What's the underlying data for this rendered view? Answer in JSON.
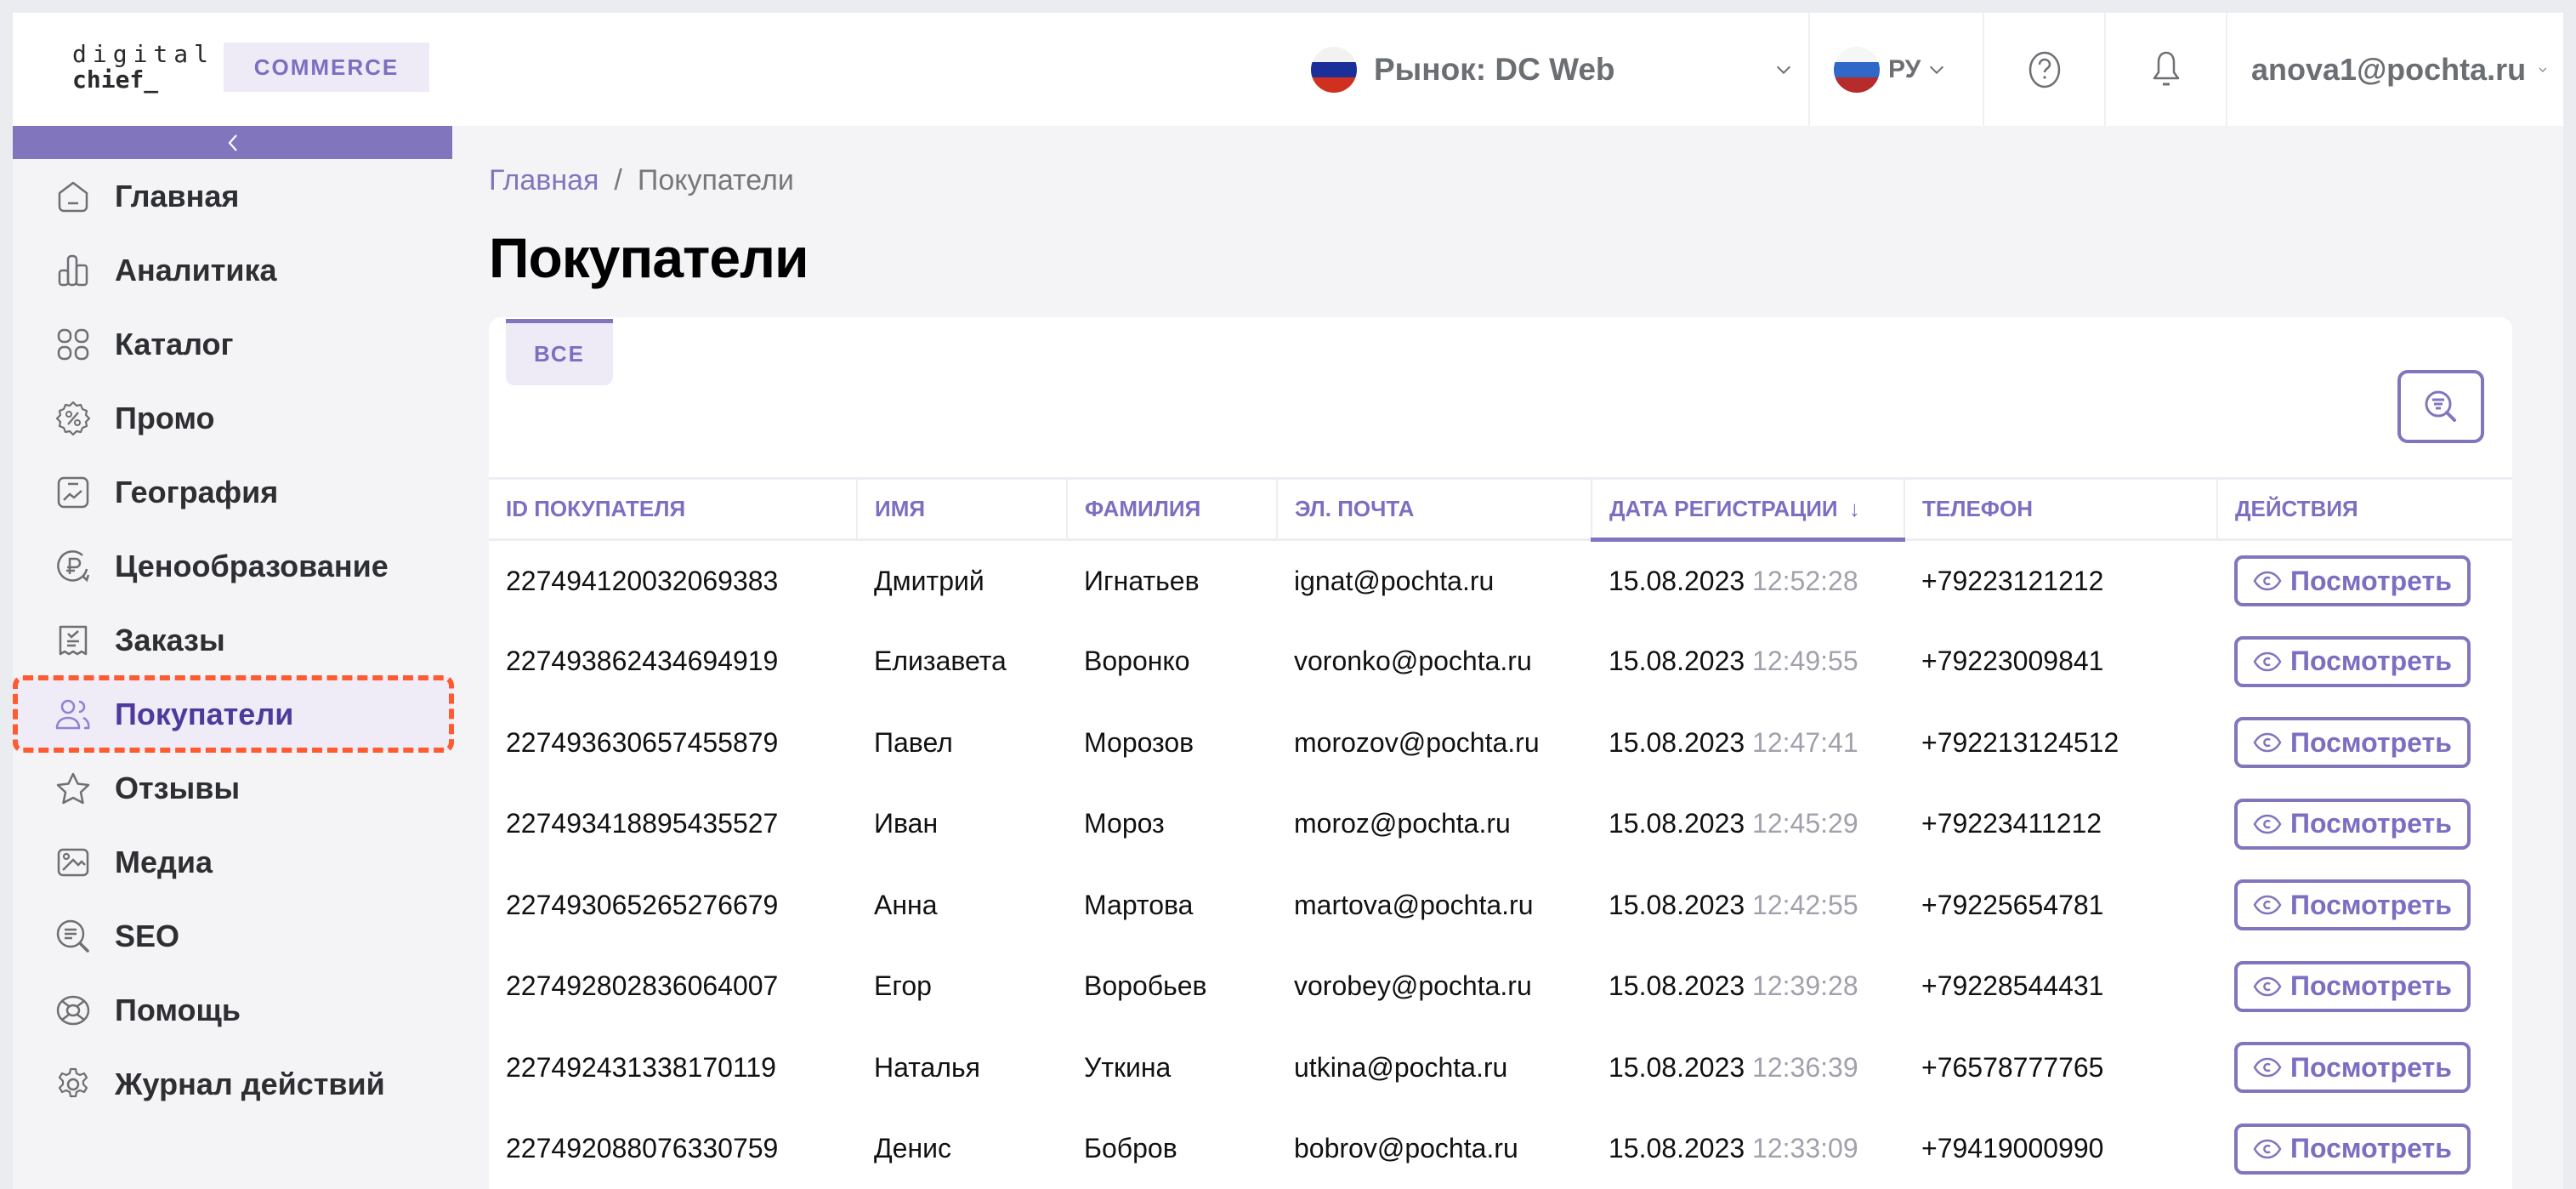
{
  "brand": {
    "logo_line1": "digital",
    "logo_line2": "chief_",
    "product_badge": "COMMERCE",
    "accent_color": "#8176bd"
  },
  "header": {
    "market_label": "Рынок: DC Web",
    "language": "РУ",
    "help_icon": "question-circle-icon",
    "notifications_icon": "bell-icon",
    "user_email": "anova1@pochta.ru"
  },
  "sidebar": {
    "collapse_icon": "chevron-left-icon",
    "items": [
      {
        "label": "Главная",
        "icon": "home-icon",
        "active": false
      },
      {
        "label": "Аналитика",
        "icon": "bar-chart-icon",
        "active": false
      },
      {
        "label": "Каталог",
        "icon": "grid-icon",
        "active": false
      },
      {
        "label": "Промо",
        "icon": "percent-badge-icon",
        "active": false
      },
      {
        "label": "География",
        "icon": "trend-chart-icon",
        "active": false
      },
      {
        "label": "Ценообразование",
        "icon": "ruble-refresh-icon",
        "active": false
      },
      {
        "label": "Заказы",
        "icon": "receipt-check-icon",
        "active": false
      },
      {
        "label": "Покупатели",
        "icon": "users-icon",
        "active": true
      },
      {
        "label": "Отзывы",
        "icon": "star-icon",
        "active": false
      },
      {
        "label": "Медиа",
        "icon": "image-icon",
        "active": false
      },
      {
        "label": "SEO",
        "icon": "search-text-icon",
        "active": false
      },
      {
        "label": "Помощь",
        "icon": "lifebuoy-icon",
        "active": false
      },
      {
        "label": "Журнал действий",
        "icon": "gear-icon",
        "active": false
      }
    ]
  },
  "breadcrumb": {
    "home": "Главная",
    "separator": "/",
    "current": "Покупатели"
  },
  "page": {
    "title": "Покупатели",
    "tab_all": "ВСЕ",
    "filter_icon": "search-filter-icon"
  },
  "table": {
    "columns": [
      "ID ПОКУПАТЕЛЯ",
      "ИМЯ",
      "ФАМИЛИЯ",
      "ЭЛ. ПОЧТА",
      "ДАТА РЕГИСТРАЦИИ",
      "ТЕЛЕФОН",
      "ДЕЙСТВИЯ"
    ],
    "sort_indicator": "↓",
    "action_label": "Посмотреть",
    "rows": [
      {
        "id": "227494120032069383",
        "first": "Дмитрий",
        "last": "Игнатьев",
        "email": "ignat@pochta.ru",
        "date": "15.08.2023",
        "time": "12:52:28",
        "phone": "+79223121212"
      },
      {
        "id": "227493862434694919",
        "first": "Елизавета",
        "last": "Воронко",
        "email": "voronko@pochta.ru",
        "date": "15.08.2023",
        "time": "12:49:55",
        "phone": "+79223009841"
      },
      {
        "id": "227493630657455879",
        "first": "Павел",
        "last": "Морозов",
        "email": "morozov@pochta.ru",
        "date": "15.08.2023",
        "time": "12:47:41",
        "phone": "+792213124512"
      },
      {
        "id": "227493418895435527",
        "first": "Иван",
        "last": "Мороз",
        "email": "moroz@pochta.ru",
        "date": "15.08.2023",
        "time": "12:45:29",
        "phone": "+79223411212"
      },
      {
        "id": "227493065265276679",
        "first": "Анна",
        "last": "Мартова",
        "email": "martova@pochta.ru",
        "date": "15.08.2023",
        "time": "12:42:55",
        "phone": "+79225654781"
      },
      {
        "id": "227492802836064007",
        "first": "Егор",
        "last": "Воробьев",
        "email": "vorobey@pochta.ru",
        "date": "15.08.2023",
        "time": "12:39:28",
        "phone": "+79228544431"
      },
      {
        "id": "227492431338170119",
        "first": "Наталья",
        "last": "Уткина",
        "email": "utkina@pochta.ru",
        "date": "15.08.2023",
        "time": "12:36:39",
        "phone": "+76578777765"
      },
      {
        "id": "227492088076330759",
        "first": "Денис",
        "last": "Бобров",
        "email": "bobrov@pochta.ru",
        "date": "15.08.2023",
        "time": "12:33:09",
        "phone": "+79419000990"
      }
    ]
  }
}
